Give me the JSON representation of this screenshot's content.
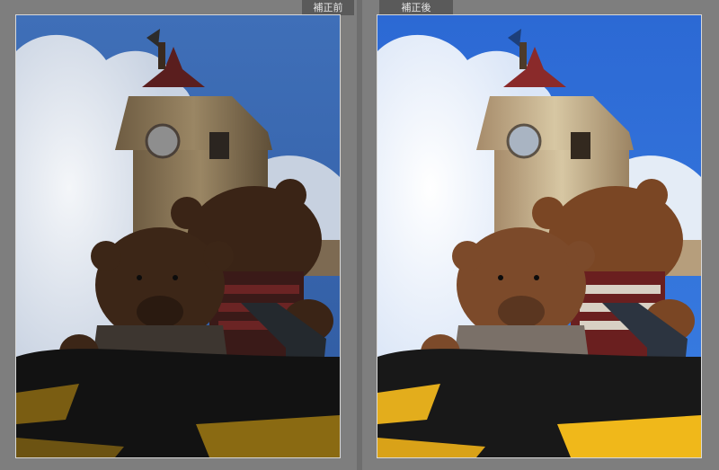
{
  "panes": {
    "before": {
      "label": "補正前"
    },
    "after": {
      "label": "補正後"
    }
  }
}
